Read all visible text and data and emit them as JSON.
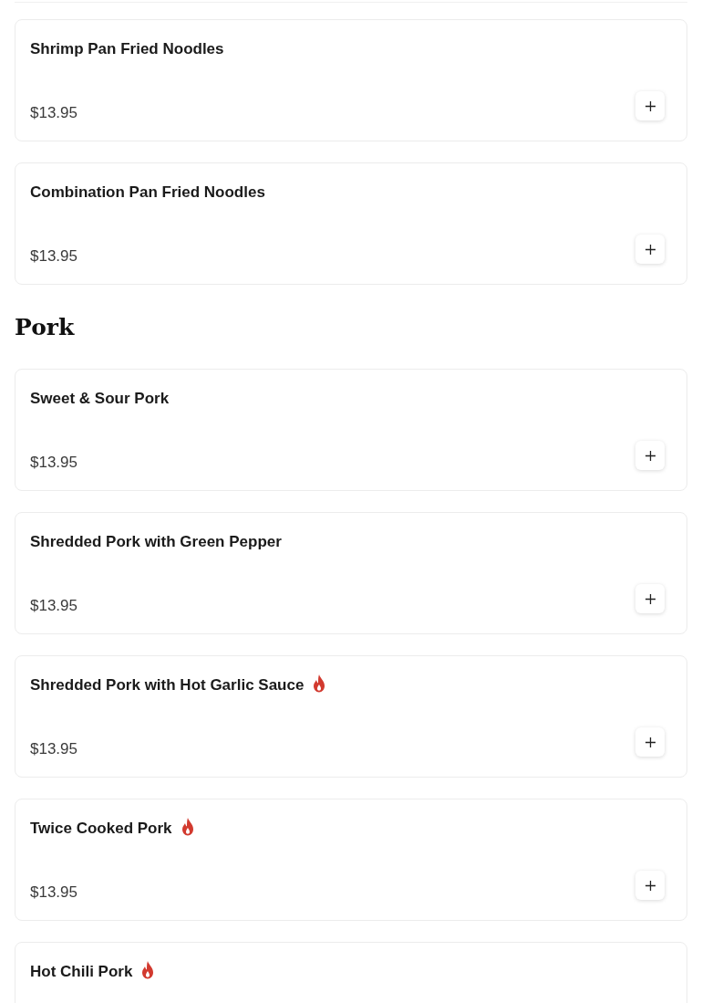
{
  "blocks": [
    {
      "kind": "item",
      "name": "Shrimp Pan Fried Noodles",
      "price": "$13.95",
      "spicy": false
    },
    {
      "kind": "item",
      "name": "Combination Pan Fried Noodles",
      "price": "$13.95",
      "spicy": false
    },
    {
      "kind": "heading",
      "title": "Pork"
    },
    {
      "kind": "item",
      "name": "Sweet & Sour Pork",
      "price": "$13.95",
      "spicy": false
    },
    {
      "kind": "item",
      "name": "Shredded Pork with Green Pepper",
      "price": "$13.95",
      "spicy": false
    },
    {
      "kind": "item",
      "name": "Shredded Pork with Hot Garlic Sauce",
      "price": "$13.95",
      "spicy": true
    },
    {
      "kind": "item",
      "name": "Twice Cooked Pork",
      "price": "$13.95",
      "spicy": true
    },
    {
      "kind": "item",
      "name": "Hot Chili Pork",
      "spicy": true
    }
  ]
}
